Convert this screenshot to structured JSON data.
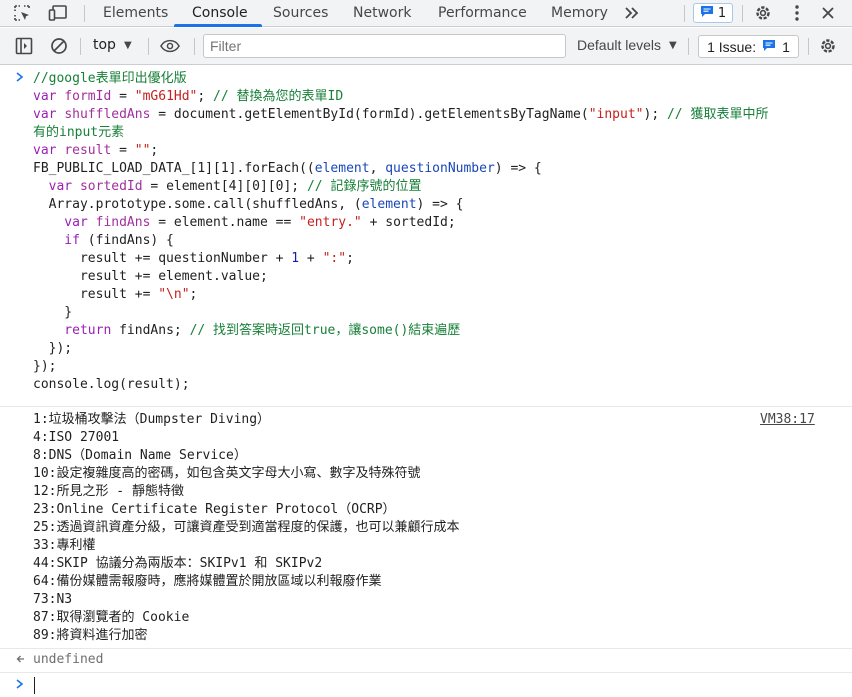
{
  "tabs": [
    "Elements",
    "Console",
    "Sources",
    "Network",
    "Performance",
    "Memory"
  ],
  "more_tabs_icon": ">>",
  "messages_badge": {
    "count": "1"
  },
  "toolbar": {
    "context": "top",
    "filter_placeholder": "Filter",
    "default_levels": "Default levels",
    "issues_label": "1 Issue:",
    "issues_count": "1"
  },
  "code": [
    [
      {
        "t": "//google表單印出優化版",
        "c": "cmt"
      }
    ],
    [
      {
        "t": "var ",
        "c": "kw"
      },
      {
        "t": "formId",
        "c": "var"
      },
      {
        "t": " = ",
        "c": "plain"
      },
      {
        "t": "\"mG61Hd\"",
        "c": "str"
      },
      {
        "t": "; ",
        "c": "plain"
      },
      {
        "t": "// 替換為您的表單ID",
        "c": "cmt"
      }
    ],
    [
      {
        "t": "var ",
        "c": "kw"
      },
      {
        "t": "shuffledAns",
        "c": "var"
      },
      {
        "t": " = document.getElementById(formId).getElementsByTagName(",
        "c": "plain"
      },
      {
        "t": "\"input\"",
        "c": "str"
      },
      {
        "t": "); ",
        "c": "plain"
      },
      {
        "t": "// 獲取表單中所",
        "c": "cmt"
      }
    ],
    [
      {
        "t": "有的input元素",
        "c": "cmt"
      }
    ],
    [
      {
        "t": "var ",
        "c": "kw"
      },
      {
        "t": "result",
        "c": "var"
      },
      {
        "t": " = ",
        "c": "plain"
      },
      {
        "t": "\"\"",
        "c": "str"
      },
      {
        "t": ";",
        "c": "plain"
      }
    ],
    [
      {
        "t": "FB_PUBLIC_LOAD_DATA_[1][1].forEach((",
        "c": "plain"
      },
      {
        "t": "element",
        "c": "var2"
      },
      {
        "t": ", ",
        "c": "plain"
      },
      {
        "t": "questionNumber",
        "c": "var2"
      },
      {
        "t": ") => {",
        "c": "plain"
      }
    ],
    [
      {
        "t": "  var ",
        "c": "kw"
      },
      {
        "t": "sortedId",
        "c": "var"
      },
      {
        "t": " = element[4][0][0]; ",
        "c": "plain"
      },
      {
        "t": "// 記錄序號的位置",
        "c": "cmt"
      }
    ],
    [
      {
        "t": "  Array.prototype.some.call(shuffledAns, (",
        "c": "plain"
      },
      {
        "t": "element",
        "c": "var2"
      },
      {
        "t": ") => {",
        "c": "plain"
      }
    ],
    [
      {
        "t": "    var ",
        "c": "kw"
      },
      {
        "t": "findAns",
        "c": "var"
      },
      {
        "t": " = element.name == ",
        "c": "plain"
      },
      {
        "t": "\"entry.\"",
        "c": "str"
      },
      {
        "t": " + sortedId;",
        "c": "plain"
      }
    ],
    [
      {
        "t": "    if",
        "c": "kw"
      },
      {
        "t": " (findAns) {",
        "c": "plain"
      }
    ],
    [
      {
        "t": "      result += questionNumber + ",
        "c": "plain"
      },
      {
        "t": "1",
        "c": "num"
      },
      {
        "t": " + ",
        "c": "plain"
      },
      {
        "t": "\":\"",
        "c": "str"
      },
      {
        "t": ";",
        "c": "plain"
      }
    ],
    [
      {
        "t": "      result += element.value;",
        "c": "plain"
      }
    ],
    [
      {
        "t": "      result += ",
        "c": "plain"
      },
      {
        "t": "\"\\n\"",
        "c": "str"
      },
      {
        "t": ";",
        "c": "plain"
      }
    ],
    [
      {
        "t": "    }",
        "c": "plain"
      }
    ],
    [
      {
        "t": "    return",
        "c": "kw"
      },
      {
        "t": " findAns; ",
        "c": "plain"
      },
      {
        "t": "// 找到答案時返回true，讓some()結束遍歷",
        "c": "cmt"
      }
    ],
    [
      {
        "t": "  });",
        "c": "plain"
      }
    ],
    [
      {
        "t": "});",
        "c": "plain"
      }
    ],
    [
      {
        "t": "console.log(result);",
        "c": "plain"
      }
    ]
  ],
  "output": {
    "source": "VM38:17",
    "lines": [
      "1:垃圾桶攻擊法（Dumpster Diving）",
      "4:ISO 27001",
      "8:DNS（Domain Name Service）",
      "10:設定複雜度高的密碼，如包含英文字母大小寫、數字及特殊符號",
      "12:所見之形 - 靜態特徵",
      "23:Online Certificate Register Protocol（OCRP）",
      "25:透過資訊資產分級，可讓資產受到適當程度的保護，也可以兼顧行成本",
      "33:專利權",
      "44:SKIP 協議分為兩版本：SKIPv1 和 SKIPv2",
      "64:備份媒體需報廢時，應將媒體置於開放區域以利報廢作業",
      "73:N3",
      "87:取得瀏覽者的 Cookie",
      "89:將資料進行加密"
    ]
  },
  "return_value": "undefined",
  "colors": {
    "accent": "#1a73e8",
    "comment": "#188038",
    "keyword": "#9a1fb5",
    "string": "#c5221f"
  }
}
